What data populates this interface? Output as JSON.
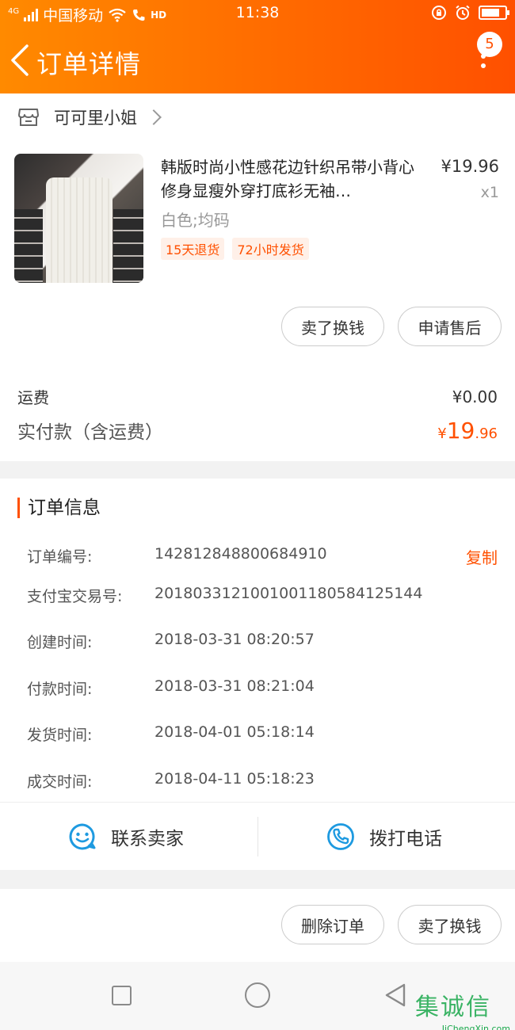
{
  "status_bar": {
    "carrier": "中国移动",
    "network": "4G",
    "hd": "HD",
    "time": "11:38"
  },
  "nav": {
    "title": "订单详情",
    "badge_count": "5"
  },
  "shop": {
    "name": "可可里小姐"
  },
  "product": {
    "name": "韩版时尚小性感花边针织吊带小背心修身显瘦外穿打底衫无袖…",
    "price": "¥19.96",
    "quantity": "x1",
    "sku": "白色;均码",
    "tags": [
      "15天退货",
      "72小时发货"
    ]
  },
  "item_actions": {
    "sell": "卖了换钱",
    "after_sale": "申请售后"
  },
  "fees": {
    "shipping_label": "运费",
    "shipping_value": "¥0.00",
    "paid_label": "实付款（含运费）",
    "paid_currency": "¥",
    "paid_int": "19",
    "paid_dec": ".96"
  },
  "order_info": {
    "title": "订单信息",
    "copy_label": "复制",
    "rows": [
      {
        "label": "订单编号:",
        "value": "142812848800684910"
      },
      {
        "label": "支付宝交易号:",
        "value": "2018033121001001180584125144"
      },
      {
        "label": "创建时间:",
        "value": "2018-03-31 08:20:57"
      },
      {
        "label": "付款时间:",
        "value": "2018-03-31 08:21:04"
      },
      {
        "label": "发货时间:",
        "value": "2018-04-01 05:18:14"
      },
      {
        "label": "成交时间:",
        "value": "2018-04-11 05:18:23"
      }
    ],
    "contact_seller": "联系卖家",
    "call_phone": "拨打电话"
  },
  "bottom_actions": {
    "delete": "删除订单",
    "sell": "卖了换钱"
  },
  "watermark": {
    "main": "集诚信",
    "sub": "JiChengXin.com"
  },
  "colors": {
    "accent": "#ff5000",
    "header_start": "#ff8a00",
    "header_end": "#ff5000",
    "icon_blue": "#1e9ae0"
  }
}
